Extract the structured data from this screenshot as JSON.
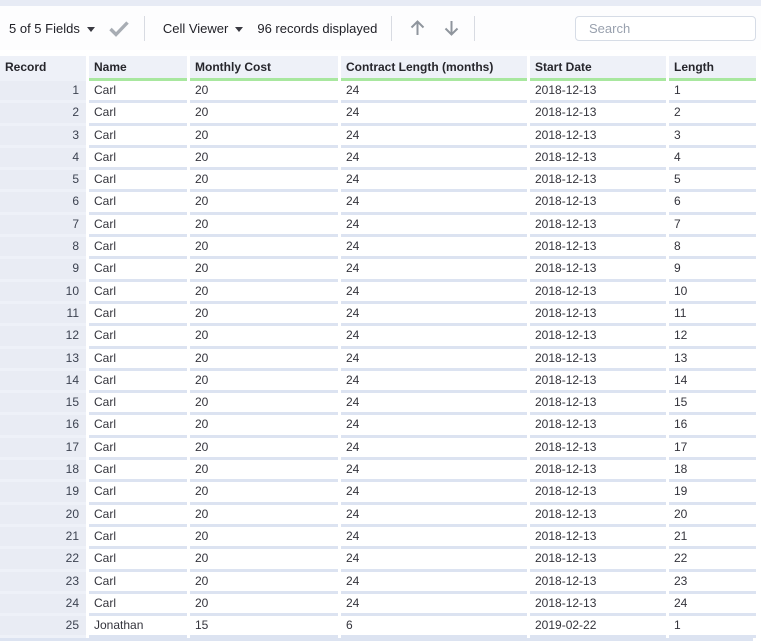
{
  "toolbar": {
    "fields_dropdown_label": "5 of 5 Fields",
    "cell_viewer_dropdown_label": "Cell Viewer",
    "records_status": "96 records displayed",
    "search_placeholder": "Search",
    "icons": [
      "dropdown-caret",
      "apply-check-icon",
      "arrow-up-icon",
      "arrow-down-icon",
      "search-icon"
    ]
  },
  "table": {
    "columns": [
      "Record",
      "Name",
      "Monthly Cost",
      "Contract Length (months)",
      "Start Date",
      "Length"
    ],
    "rows": [
      [
        "1",
        "Carl",
        "20",
        "24",
        "2018-12-13",
        "1"
      ],
      [
        "2",
        "Carl",
        "20",
        "24",
        "2018-12-13",
        "2"
      ],
      [
        "3",
        "Carl",
        "20",
        "24",
        "2018-12-13",
        "3"
      ],
      [
        "4",
        "Carl",
        "20",
        "24",
        "2018-12-13",
        "4"
      ],
      [
        "5",
        "Carl",
        "20",
        "24",
        "2018-12-13",
        "5"
      ],
      [
        "6",
        "Carl",
        "20",
        "24",
        "2018-12-13",
        "6"
      ],
      [
        "7",
        "Carl",
        "20",
        "24",
        "2018-12-13",
        "7"
      ],
      [
        "8",
        "Carl",
        "20",
        "24",
        "2018-12-13",
        "8"
      ],
      [
        "9",
        "Carl",
        "20",
        "24",
        "2018-12-13",
        "9"
      ],
      [
        "10",
        "Carl",
        "20",
        "24",
        "2018-12-13",
        "10"
      ],
      [
        "11",
        "Carl",
        "20",
        "24",
        "2018-12-13",
        "11"
      ],
      [
        "12",
        "Carl",
        "20",
        "24",
        "2018-12-13",
        "12"
      ],
      [
        "13",
        "Carl",
        "20",
        "24",
        "2018-12-13",
        "13"
      ],
      [
        "14",
        "Carl",
        "20",
        "24",
        "2018-12-13",
        "14"
      ],
      [
        "15",
        "Carl",
        "20",
        "24",
        "2018-12-13",
        "15"
      ],
      [
        "16",
        "Carl",
        "20",
        "24",
        "2018-12-13",
        "16"
      ],
      [
        "17",
        "Carl",
        "20",
        "24",
        "2018-12-13",
        "17"
      ],
      [
        "18",
        "Carl",
        "20",
        "24",
        "2018-12-13",
        "18"
      ],
      [
        "19",
        "Carl",
        "20",
        "24",
        "2018-12-13",
        "19"
      ],
      [
        "20",
        "Carl",
        "20",
        "24",
        "2018-12-13",
        "20"
      ],
      [
        "21",
        "Carl",
        "20",
        "24",
        "2018-12-13",
        "21"
      ],
      [
        "22",
        "Carl",
        "20",
        "24",
        "2018-12-13",
        "22"
      ],
      [
        "23",
        "Carl",
        "20",
        "24",
        "2018-12-13",
        "23"
      ],
      [
        "24",
        "Carl",
        "20",
        "24",
        "2018-12-13",
        "24"
      ],
      [
        "25",
        "Jonathan",
        "15",
        "6",
        "2019-02-22",
        "1"
      ]
    ]
  },
  "colors": {
    "header_underline_green": "#a8e79f",
    "record_column_bg": "#e9ecf4",
    "header_bg": "#eef1f8",
    "row_divider": "#dce3f1",
    "toolbar_strip": "#e7ebf5"
  }
}
